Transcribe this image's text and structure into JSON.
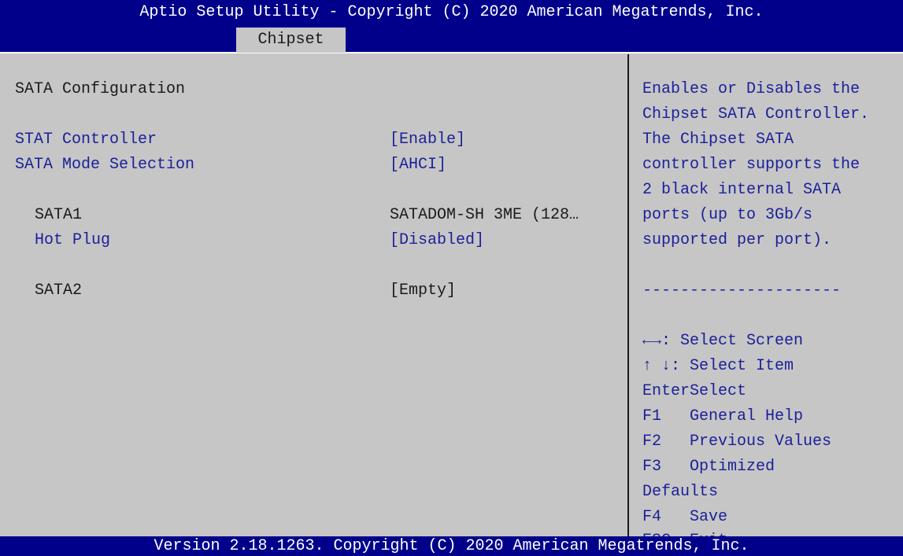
{
  "header": {
    "title": "Aptio Setup Utility - Copyright (C) 2020 American Megatrends, Inc.",
    "active_tab": "Chipset"
  },
  "main": {
    "section_title": "SATA Configuration",
    "rows": [
      {
        "label": "STAT Controller",
        "value": "[Enable]"
      },
      {
        "label": "SATA Mode Selection",
        "value": "[AHCI]"
      },
      {
        "label": "SATA1",
        "value": "SATADOM-SH 3ME (128…"
      },
      {
        "label": "Hot Plug",
        "value": "[Disabled]"
      },
      {
        "label": "SATA2",
        "value": "[Empty]"
      }
    ]
  },
  "help": {
    "description_lines": [
      "Enables or Disables the",
      "Chipset SATA Controller.",
      "The Chipset SATA",
      "controller supports the",
      "2 black internal SATA",
      "ports (up to 3Gb/s",
      "supported per port)."
    ],
    "separator": "---------------------",
    "keys": [
      "←→: Select Screen",
      "↑ ↓: Select Item",
      "EnterSelect",
      "F1   General Help",
      "F2   Previous Values",
      "F3   Optimized",
      "Defaults",
      "F4   Save",
      "ESC  Exit"
    ]
  },
  "footer": {
    "version": "Version 2.18.1263. Copyright (C) 2020 American Megatrends, Inc."
  },
  "colors": {
    "bar_blue": "#00008b",
    "background_gray": "#c6c6c6",
    "link_blue": "#1b1f99"
  }
}
